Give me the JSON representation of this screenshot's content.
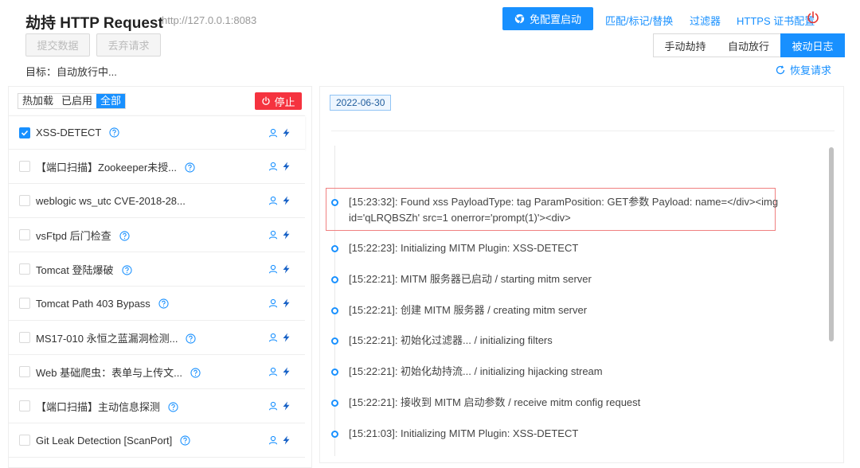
{
  "header": {
    "title": "劫持 HTTP Request",
    "url": "http://127.0.0.1:8083",
    "submit_label": "提交数据",
    "discard_label": "丢弃请求",
    "target_text": "目标：自动放行中...",
    "start_label": "免配置启动",
    "match_label": "匹配/标记/替换",
    "filter_label": "过滤器",
    "https_label": "HTTPS 证书配置",
    "modes": [
      "手动劫持",
      "自动放行",
      "被动日志"
    ],
    "active_mode": "被动日志",
    "restore_label": "恢复请求"
  },
  "left": {
    "filters": [
      "热加载",
      "已启用",
      "全部"
    ],
    "active_filter": "全部",
    "stop_label": "停止",
    "plugins": [
      {
        "name": "XSS-DETECT",
        "checked": true,
        "help": true
      },
      {
        "name": "【端口扫描】Zookeeper未授...",
        "checked": false,
        "help": true
      },
      {
        "name": "weblogic ws_utc CVE-2018-28...",
        "checked": false,
        "help": false
      },
      {
        "name": "vsFtpd 后门检查",
        "checked": false,
        "help": true
      },
      {
        "name": "Tomcat 登陆爆破",
        "checked": false,
        "help": true
      },
      {
        "name": "Tomcat Path 403 Bypass",
        "checked": false,
        "help": true
      },
      {
        "name": "MS17-010 永恒之蓝漏洞检测...",
        "checked": false,
        "help": true
      },
      {
        "name": "Web 基础爬虫：表单与上传文...",
        "checked": false,
        "help": true
      },
      {
        "name": "【端口扫描】主动信息探测",
        "checked": false,
        "help": true
      },
      {
        "name": "Git Leak Detection [ScanPort]",
        "checked": false,
        "help": true
      }
    ]
  },
  "right": {
    "date": "2022-06-30",
    "logs": [
      {
        "line1": "[15:23:32]: Found xss PayloadType: tag ParamPosition: GET参数 Payload: name=</div><img",
        "line2": "id='qLRQBSZh' src=1 onerror='prompt(1)'><div>"
      },
      {
        "line1": "[15:22:23]: Initializing MITM Plugin: XSS-DETECT"
      },
      {
        "line1": "[15:22:21]: MITM 服务器已启动 / starting mitm server"
      },
      {
        "line1": "[15:22:21]: 创建 MITM 服务器 / creating mitm server"
      },
      {
        "line1": "[15:22:21]: 初始化过滤器... / initializing filters"
      },
      {
        "line1": "[15:22:21]: 初始化劫持流... / initializing hijacking stream"
      },
      {
        "line1": "[15:22:21]: 接收到 MITM 启动参数 / receive mitm config request"
      },
      {
        "line1": "[15:21:03]: Initializing MITM Plugin: XSS-DETECT"
      }
    ]
  },
  "colors": {
    "primary": "#1890ff",
    "danger": "#f5333f",
    "highlight_border": "#f08080"
  }
}
